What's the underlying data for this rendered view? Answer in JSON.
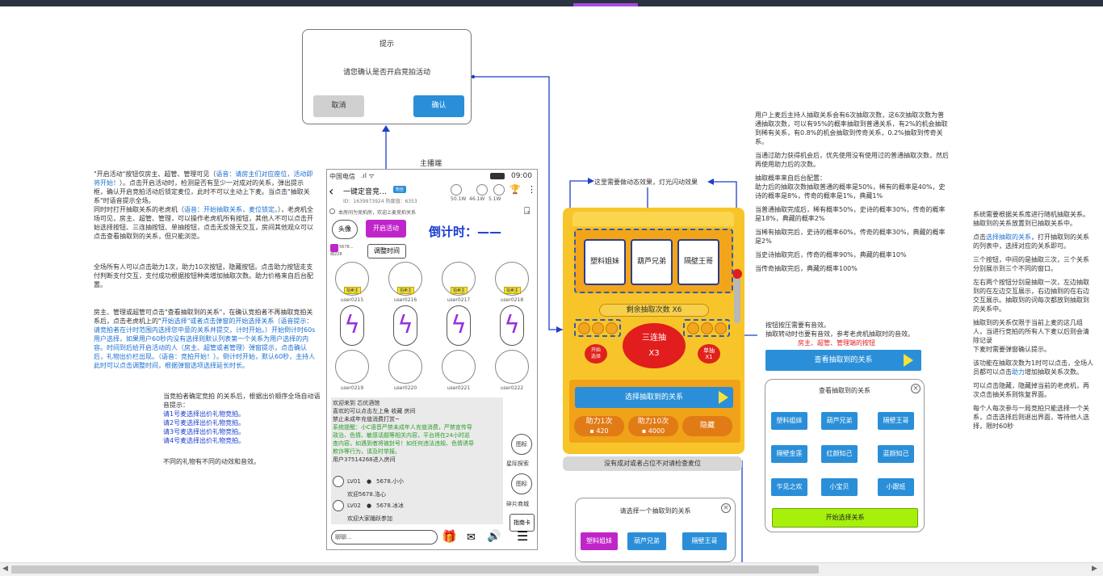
{
  "dialog": {
    "title": "提示",
    "message": "请您确认是否开启竞拍活动",
    "cancel": "取消",
    "confirm": "确认"
  },
  "phone_label": "主播端",
  "phone": {
    "carrier": "中国电信",
    "time": "09:00",
    "room_name": "一键定音竞…",
    "badge": "粉丝",
    "id_line": "ID：1639973924   热度值：6353",
    "notice": "本房间为竞拍房，欢迎上麦竞拍关系",
    "mic_stats": [
      "50.1W",
      "46.1W",
      "5.1W"
    ],
    "avatar_btn": "头像",
    "start_btn": "开启活动",
    "countdown": "倒计时：——",
    "adjust_btn": "调整时间",
    "host_small": [
      "5678...",
      "纳228"
    ],
    "tags": [
      "拍卖主",
      "拍卖主",
      "拍卖主",
      "拍卖主"
    ],
    "users_row1": [
      "user0215",
      "user0216",
      "user0217",
      "user0218"
    ],
    "users_row2": [
      "user0219",
      "user0220",
      "user0221",
      "user0222"
    ],
    "chat_lines": [
      {
        "text": "欢迎来到 芯优酒馆",
        "c": "#333"
      },
      {
        "text": "喜欢的可以点击左上角 收藏 房间",
        "c": "#333"
      },
      {
        "text": "禁止未成年充值消费打赏~",
        "c": "#333"
      },
      {
        "text": "系统提醒：小C语音严禁未成年人充值消费，严禁宣传导",
        "c": "#2a9d2a"
      },
      {
        "text": "政治、色情、敏感话题等相关内容，平台将在24小时巡",
        "c": "#2a9d2a"
      },
      {
        "text": "查内容，如遇到者将被封号！如任何违法违规、色情诱导",
        "c": "#2a9d2a"
      },
      {
        "text": "欺诈等行为，请及时举报。",
        "c": "#2a9d2a"
      },
      {
        "text": "用户37514268进入房间",
        "c": "#333"
      }
    ],
    "chat_users": [
      {
        "lv": "LV01",
        "name": "5678.小小",
        "msg": "欢迎5678.洛心"
      },
      {
        "lv": "LV02",
        "name": "5678.冰冰",
        "msg": "欢迎大家踊跃参加"
      }
    ],
    "input_placeholder": "聊聊...",
    "side_btns": [
      "图标",
      "图标",
      "指南卡"
    ],
    "side_labels": [
      "星际探索",
      "碎片商城"
    ]
  },
  "left_text": {
    "p1": "\"开启活动\"按钮仅房主、超管、管理可见（",
    "p1b": "语音：请房主们对应座位，活动即将开始！",
    "p1c": "）。点击开启活动时，检测是否有至少一对成对的关系，弹出提示框，确认开启竞拍活动后锁定麦位，此时不可以主动上下麦。当点击\"抽取关系\"时语音提示全场。",
    "p2": "同时时打开抽取关系的老虎机（",
    "p2b": "语音：开始抽取关系，麦位锁定。",
    "p2c": "），老虎机全场可见，房主、超管、管理，可以操作老虎机所有按钮，其他人不可以点击开始选择按钮、三连抽按钮、单抽按钮，点击无反馈无交互，房间其他观众可以点击查看抽取到的关系，但只能浏览。",
    "p3": "全场所有人可以点击助力1次，助力10次按钮，隐藏按钮。点击助力按钮走支付判断支付交互，支付成功根据按钮种类增加抽取次数。助力价格来自后台配置。",
    "p4a": "房主、管理或超管可点击\"查看抽取到的关系\"，在确认竞拍者不再抽取竞拍关系后，点击老虎机上的\"",
    "p4b": "开始选择",
    "p4c": "\"或者点击弹窗的开始选择关系（语音提示：请竞拍者在计时范围内选择您中意的关系并提交，计时开始。）开始倒计时60s用户选择，如果用户60秒内没有选择则默认列表第一个关系为用户选择的内容。时间到后给开启活动的人（房主、超管或者管理）弹窗提示，点击确认后，礼物出价栏出现。（语音：竞拍开始！）。倒计时开始，默认60秒，主持人此时可以点击调整时间，根据弹窗选项选择延长时长。",
    "p5": "当竞拍者确定竞拍 的关系后，根据出价顺序全场自动语音提示：",
    "list": [
      "请1号麦选择出价礼物竞拍。",
      "请2号麦选择出价礼物竞拍。",
      "请3号麦选择出价礼物竞拍。",
      "请4号麦选择出价礼物竞拍。"
    ],
    "p6": "不同的礼物有不同的动效和音效。"
  },
  "machine": {
    "note": "这里需要做动态效果，灯光闪动效果",
    "reels": [
      "塑料姐妹",
      "葫芦兄弟",
      "隔壁王哥"
    ],
    "remain": "剩余抽取次数  X6",
    "start_btn": [
      "开始",
      "选择"
    ],
    "triple": "三连抽",
    "triple_x": "X3",
    "single": "单抽",
    "single_x": "X1",
    "select_bar": "选择抽取到的关系",
    "help1": "助力1次",
    "help1_price": "420",
    "help10": "助力10次",
    "help10_price": "4000",
    "hide": "隐藏",
    "gray_note": "没有成对或者占位不对请检查麦位"
  },
  "select_dialog": {
    "title": "请选择一个抽取到的关系",
    "items": [
      "塑料姐妹",
      "葫芦兄弟",
      "隔壁王哥"
    ]
  },
  "mid_right_text": {
    "p1": "用户上麦后主持人抽取关系会有6次抽取次数，这6次抽取次数为普通抽取次数，可以有95%的概率抽取到普通关系，有2%的机会抽取到稀有关系，有0.8%的机会抽取到传奇关系，0.2%抽取到传奇关系。",
    "p2": "当通过助力获得机会后，优先使用没有使用过的普通抽取次数，然后再使用助力后的次数。",
    "p3": "抽取概率来自后台配置：",
    "p3b": "助力后的抽取次数抽取普通的概率是50%，稀有的概率是40%，史诗的概率是8%，传奇的概率是1%，典藏1%",
    "p4": "当普通抽取完成后，稀有概率50%，史诗的概率30%，传奇的概率是18%，典藏的概率2%",
    "p5": "当稀有抽取完后，史诗的概率60%，传奇的概率30%，典藏的概率是2%",
    "p6": "当史诗抽取完后，传奇的概率90%，典藏的概率10%",
    "p7": "当传奇抽取完后，典藏的概率100%",
    "p8": "按钮按压需要有音效。",
    "p9": "抽取转动时也要有音效，参考老虎机抽取时的音效。",
    "p10": "房主、超管、管理端的按钮"
  },
  "view": {
    "bar": "查看抽取到的关系",
    "title": "查看抽取到的关系",
    "items": [
      "塑料姐妹",
      "葫芦兄弟",
      "隔壁王哥",
      "隔壁金莲",
      "红颜知己",
      "蓝颜知己",
      "乍见之欢",
      "小宝贝",
      "小跟班"
    ],
    "start": "开始选择关系"
  },
  "far_right_text": {
    "p1": "系统需要根据关系库进行随机抽取关系。抽取到的关系放置到已抽取关系中。",
    "p2a": "点击",
    "p2b": "选择抽取的关系",
    "p2c": "，打开抽取到的关系的列表中，选择对应的关系即可。",
    "p3": "三个按钮，中间的是抽取三次，三个关系分别展示到三个不同的窗口。",
    "p4": "左右两个按钮分别是抽取一次，左边抽取到的在左边交互展示，右边抽到的在右边交互展示。抽取到的词每次都放到抽取到的关系中。",
    "p5": "抽取到的关系仅限于当前上麦的这几组人，当进行竞拍的所有人下麦以后则会清除记录",
    "p5b": "下麦时需要弹窗确认提示。",
    "p6a": "该功能在抽取次数为1时可以点击，全场人员都可以点击",
    "p6b": "助力",
    "p6c": "增加抽取关系次数。",
    "p7": "可以点击隐藏，隐藏掉当前的老虎机，再次点击抽关系则恢复界面。",
    "p8": "每个人每次参与一局竞拍只能选择一个关系，点击选择后则退出界面，等待他人选择，限时60秒"
  },
  "colors": {
    "blue": "#2a8fd8",
    "purple": "#c025c9",
    "lime": "#a6f00c",
    "yellow": "#f7c52a",
    "orange": "#e07b16",
    "red": "#e21d1d"
  }
}
